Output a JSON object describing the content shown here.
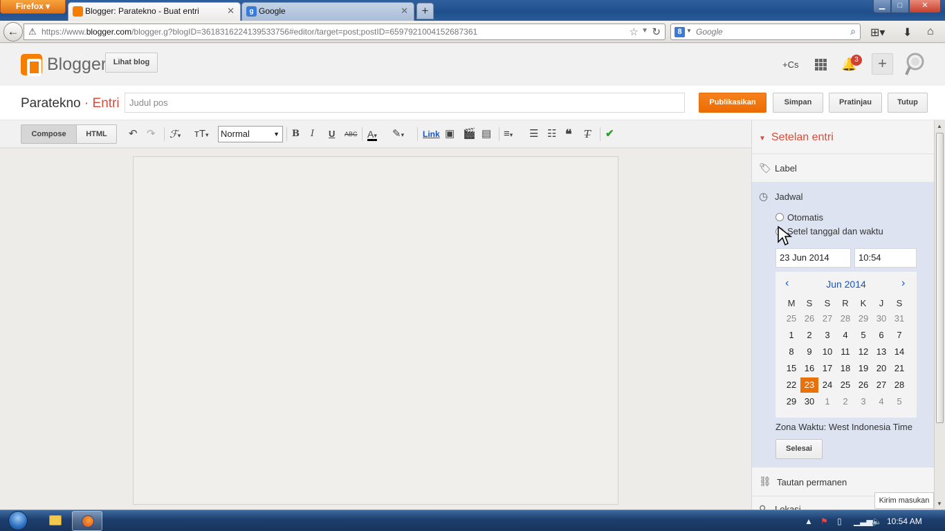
{
  "browser": {
    "menu_label": "Firefox",
    "tabs": [
      {
        "label": "Blogger: Paratekno - Buat entri",
        "active": true
      },
      {
        "label": "Google",
        "active": false
      }
    ],
    "url_prefix": "https://www.",
    "url_host": "blogger.com",
    "url_rest": "/blogger.g?blogID=3618316224139533756#editor/target=post;postID=6597921004152687361",
    "search_placeholder": "Google",
    "window_controls": {
      "minimize": "▁",
      "maximize": "□",
      "close": "✕"
    }
  },
  "blogger_header": {
    "brand": "Blogger",
    "view_blog_label": "Lihat blog",
    "plus_label": "+Cs",
    "notification_count": "3",
    "create_label": "+"
  },
  "title_row": {
    "blog_name": "Paratekno",
    "separator": "·",
    "section": "Entri",
    "title_placeholder": "Judul pos",
    "publish_label": "Publikasikan",
    "save_label": "Simpan",
    "preview_label": "Pratinjau",
    "close_label": "Tutup"
  },
  "toolbar": {
    "compose_label": "Compose",
    "html_label": "HTML",
    "format_value": "Normal",
    "link_label": "Link",
    "icons": [
      "undo-icon",
      "redo-icon",
      "font-icon",
      "font-size-icon",
      "bold-icon",
      "italic-icon",
      "underline-icon",
      "strikethrough-icon",
      "text-color-icon",
      "highlight-icon",
      "image-icon",
      "video-icon",
      "jump-break-icon",
      "align-icon",
      "numbered-list-icon",
      "bulleted-list-icon",
      "quote-icon",
      "clear-format-icon",
      "spellcheck-icon"
    ]
  },
  "post_settings": {
    "title": "Setelan entri",
    "label_row": "Label",
    "schedule": {
      "title": "Jadwal",
      "option_auto": "Otomatis",
      "option_manual": "Setel tanggal dan waktu",
      "selected_option": "manual",
      "date_value": "23 Jun 2014",
      "time_value": "10:54",
      "calendar": {
        "month_label": "Jun 2014",
        "prev": "‹",
        "next": "›",
        "weekdays": [
          "M",
          "S",
          "S",
          "R",
          "K",
          "J",
          "S"
        ],
        "weeks": [
          [
            "25",
            "26",
            "27",
            "28",
            "29",
            "30",
            "31"
          ],
          [
            "1",
            "2",
            "3",
            "4",
            "5",
            "6",
            "7"
          ],
          [
            "8",
            "9",
            "10",
            "11",
            "12",
            "13",
            "14"
          ],
          [
            "15",
            "16",
            "17",
            "18",
            "19",
            "20",
            "21"
          ],
          [
            "22",
            "23",
            "24",
            "25",
            "26",
            "27",
            "28"
          ],
          [
            "29",
            "30",
            "1",
            "2",
            "3",
            "4",
            "5"
          ]
        ],
        "selected_day": "23"
      },
      "timezone": "Zona Waktu: West Indonesia Time",
      "done_label": "Selesai"
    },
    "permalink_row": "Tautan permanen",
    "location_row": "Lokasi"
  },
  "feedback_label": "Kirim masukan",
  "taskbar": {
    "clock": "10:54 AM"
  },
  "colors": {
    "accent_orange": "#f57d00",
    "publish_orange": "#ed6c02",
    "settings_red": "#dd4b39",
    "calendar_blue": "#1155cc",
    "schedule_bg": "#dde3f1"
  }
}
